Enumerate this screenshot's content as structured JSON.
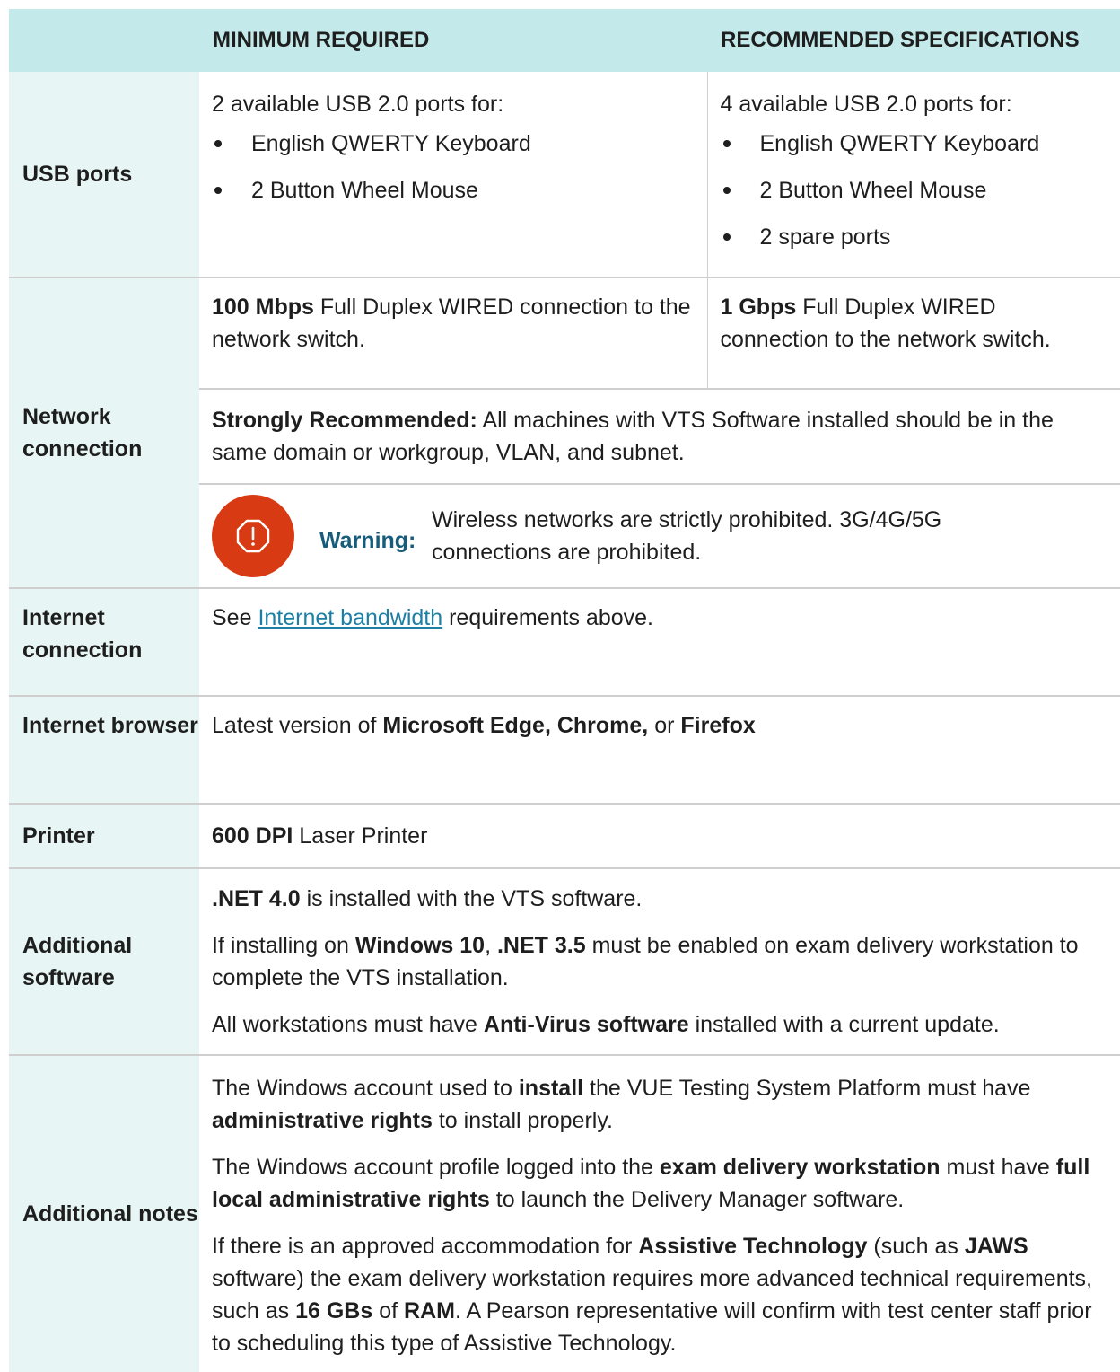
{
  "header": {
    "min_label": "MINIMUM REQUIRED",
    "rec_label": "RECOMMENDED SPECIFICATIONS"
  },
  "usb": {
    "label": "USB ports",
    "min_intro": "2 available USB 2.0 ports for:",
    "min_items": [
      "English QWERTY Keyboard",
      "2 Button Wheel Mouse"
    ],
    "rec_intro": "4 available USB 2.0 ports for:",
    "rec_items": [
      "English QWERTY Keyboard",
      "2 Button Wheel Mouse",
      "2 spare ports"
    ]
  },
  "network": {
    "label": "Network connection",
    "min_bold": "100 Mbps",
    "min_text": " Full Duplex WIRED connection to the network switch.",
    "rec_bold": "1 Gbps",
    "rec_text": " Full Duplex WIRED connection to the network switch.",
    "recommended_bold": "Strongly Recommended:",
    "recommended_text": " All machines with VTS Software installed should be in the same domain or workgroup, VLAN, and subnet.",
    "warning_icon": "alert-octagon-icon",
    "warning_label": "Warning:",
    "warning_text": "Wireless networks are strictly prohibited. 3G/4G/5G connections are prohibited."
  },
  "internet": {
    "label": "Internet connection",
    "pre": "See ",
    "link": "Internet bandwidth",
    "post": " requirements above."
  },
  "browser": {
    "label": "Internet browser",
    "pre": "Latest version of ",
    "bold1": "Microsoft Edge, Chrome,",
    "mid": " or ",
    "bold2": "Firefox"
  },
  "printer": {
    "label": "Printer",
    "bold": "600 DPI",
    "text": " Laser Printer"
  },
  "software": {
    "label": "Additional software",
    "p1_bold": ".NET 4.0",
    "p1_text": " is installed with the VTS software.",
    "p2_a": "If installing on ",
    "p2_b": "Windows 10",
    "p2_c": ", ",
    "p2_d": ".NET 3.5",
    "p2_e": " must be enabled on exam delivery workstation to complete the VTS installation.",
    "p3_a": "All workstations must have ",
    "p3_b": "Anti-Virus software",
    "p3_c": " installed with a current update."
  },
  "notes": {
    "label": "Additional notes",
    "p1_a": "The Windows account used to ",
    "p1_b": "install",
    "p1_c": " the VUE Testing System Platform must have ",
    "p1_d": "administrative rights",
    "p1_e": " to install properly.",
    "p2_a": "The Windows account profile logged into the ",
    "p2_b": "exam delivery workstation",
    "p2_c": " must have ",
    "p2_d": "full local administrative rights",
    "p2_e": " to launch the Delivery Manager software.",
    "p3_a": "If there is an approved accommodation for ",
    "p3_b": "Assistive Technology",
    "p3_c": " (such as ",
    "p3_d": "JAWS",
    "p3_e": " software) the exam delivery workstation requires more advanced technical requirements, such as ",
    "p3_f": "16 GBs",
    "p3_g": " of ",
    "p3_h": "RAM",
    "p3_i": ". A Pearson representative will confirm with test center staff prior to scheduling this type of Assistive Technology."
  },
  "colors": {
    "header_bg": "#c3e9ea",
    "label_bg": "#e8f5f5",
    "warning_red": "#d83b13",
    "warning_label": "#175c7a",
    "link": "#1d7fa4"
  }
}
